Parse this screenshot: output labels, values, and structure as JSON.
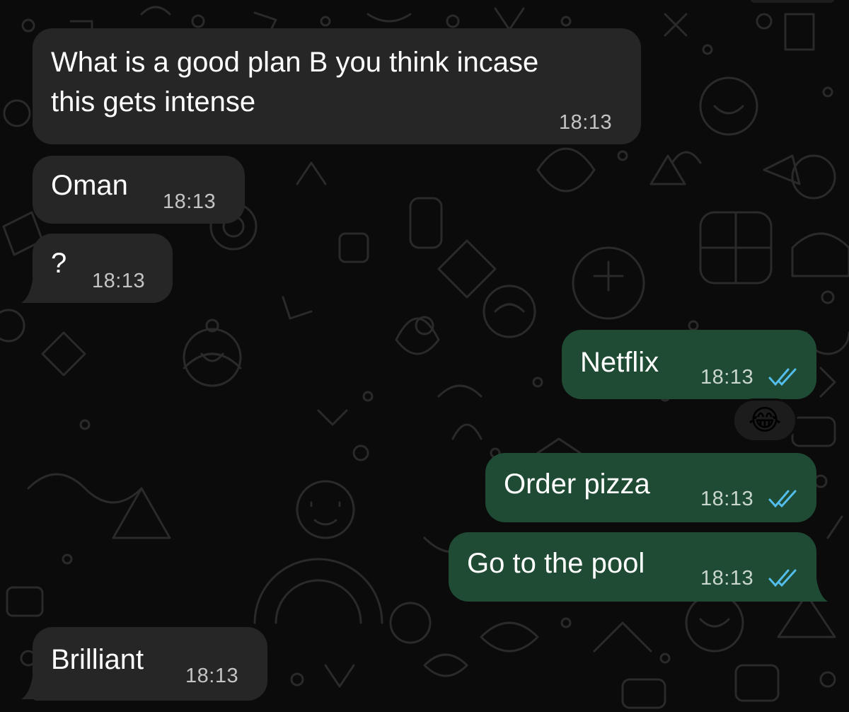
{
  "chat": {
    "incoming_color": "#262626",
    "outgoing_color": "#1f4a33",
    "read_receipt_color": "#53bdeb",
    "messages": [
      {
        "direction": "incoming",
        "text": "What is a good plan B you think incase\nthis gets intense",
        "time": "18:13"
      },
      {
        "direction": "incoming",
        "text": "Oman",
        "time": "18:13"
      },
      {
        "direction": "incoming",
        "text": "?",
        "time": "18:13"
      },
      {
        "direction": "outgoing",
        "text": "Netflix",
        "time": "18:13",
        "status": "read"
      },
      {
        "direction": "outgoing",
        "text": "Order pizza",
        "time": "18:13",
        "status": "read"
      },
      {
        "direction": "outgoing",
        "text": "Go to the pool",
        "time": "18:13",
        "status": "read"
      },
      {
        "direction": "incoming",
        "text": "Brilliant",
        "time": "18:13"
      }
    ],
    "reaction": {
      "emoji": "😂",
      "on_message_index": 3
    }
  }
}
